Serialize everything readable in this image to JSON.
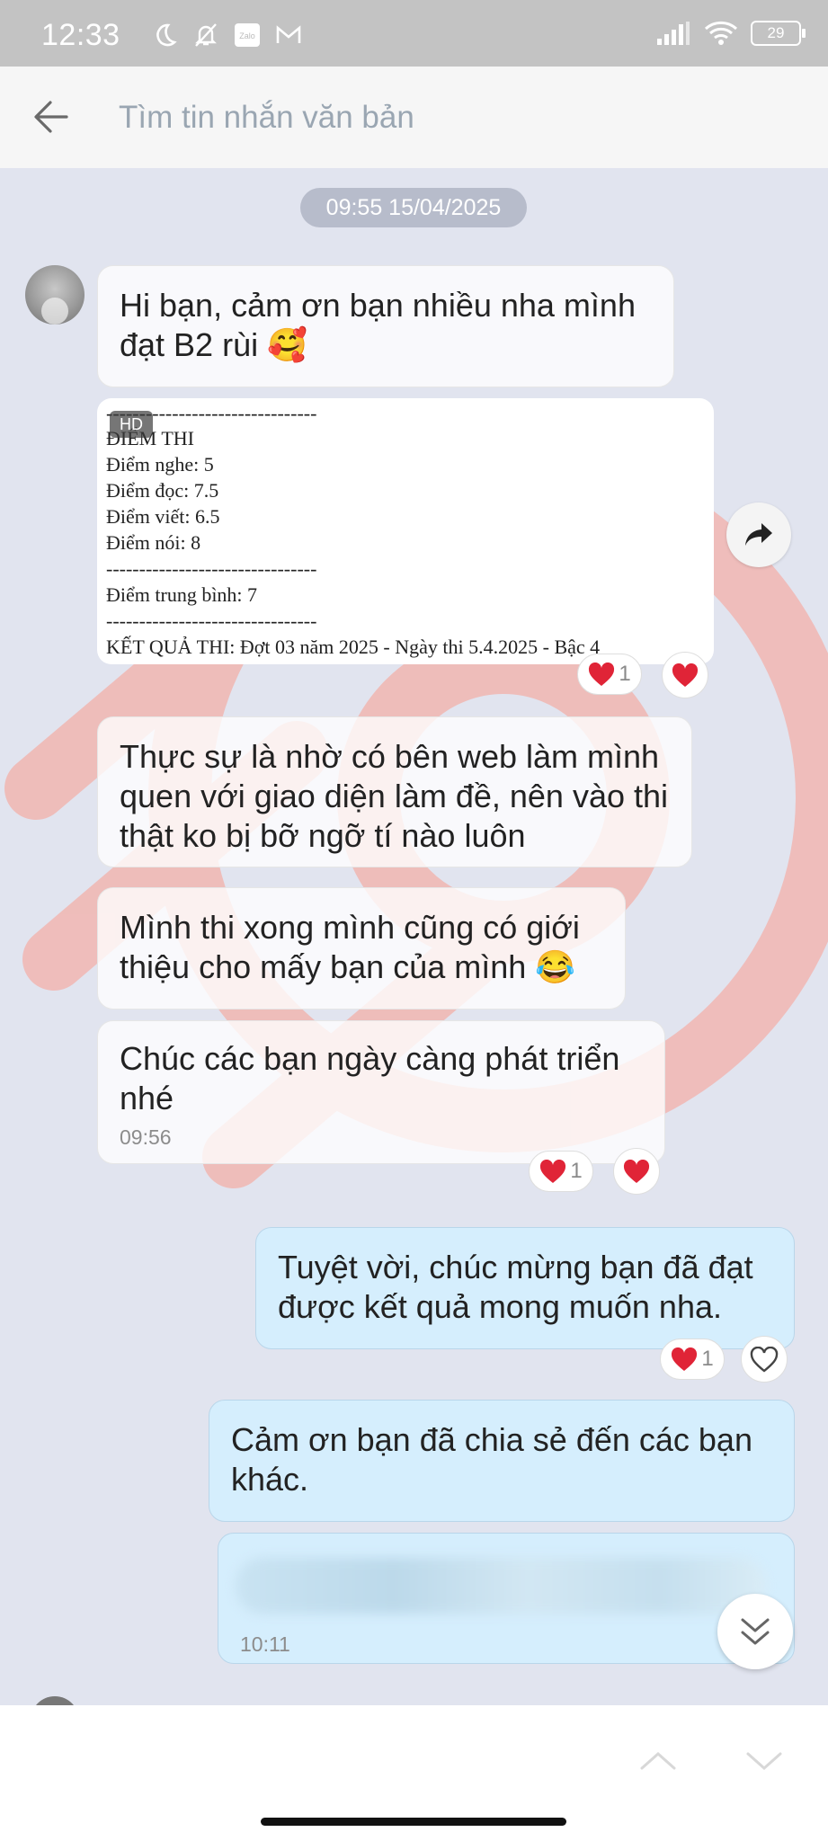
{
  "status_bar": {
    "time": "12:33",
    "battery": "29",
    "icons": [
      "moon-icon",
      "bell-off-icon",
      "zalo-icon",
      "gmail-icon",
      "signal-icon",
      "wifi-icon",
      "battery-icon"
    ]
  },
  "search": {
    "placeholder": "Tìm tin nhắn văn bản"
  },
  "chat": {
    "date_divider": "09:55 15/04/2025",
    "messages": [
      {
        "side": "in",
        "text": "Hi bạn, cảm ơn bạn nhiều nha mình đạt B2 rùi 🥰"
      },
      {
        "side": "in",
        "type": "image",
        "badge": "HD",
        "lines": [
          "--------------------------------",
          "ĐIỂM THI",
          "Điểm nghe: 5",
          "Điểm đọc: 7.5",
          "Điểm viết: 6.5",
          "Điểm nói: 8",
          "--------------------------------",
          "Điểm trung bình: 7",
          "--------------------------------",
          "KẾT QUẢ THI: Đợt 03 năm 2025 - Ngày thi 5.4.2025 - Bậc 4"
        ],
        "reaction_count": "1"
      },
      {
        "side": "in",
        "text": "Thực sự là nhờ có bên web làm mình quen với giao diện làm đề, nên vào thi thật ko bị bỡ ngỡ tí nào luôn"
      },
      {
        "side": "in",
        "text": "Mình thi xong mình cũng có giới thiệu cho mấy bạn của mình 😂"
      },
      {
        "side": "in",
        "text": "Chúc các bạn ngày càng phát triển nhé",
        "time": "09:56",
        "reaction_count": "1"
      },
      {
        "side": "out",
        "text": "Tuyệt vời, chúc mừng bạn đã đạt được kết quả mong muốn nha.",
        "reaction_count": "1"
      },
      {
        "side": "out",
        "text": "Cảm ơn bạn đã chia sẻ đến các bạn khác."
      },
      {
        "side": "out",
        "type": "blurred",
        "time": "10:11"
      }
    ]
  },
  "colors": {
    "status_bar_bg": "#c3c3c3",
    "chat_bg": "#e1e4ef",
    "outgoing_bubble": "#d5eefd",
    "incoming_bubble": "#ffffff",
    "heart": "#e02437",
    "watermark": "#f0a7a0"
  }
}
